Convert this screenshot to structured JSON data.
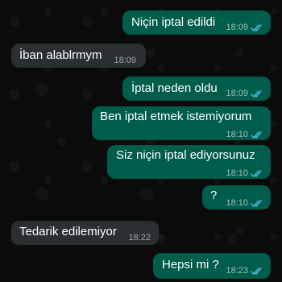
{
  "messages": [
    {
      "text": "Niçin iptal edildi",
      "time": "18:09",
      "direction": "outgoing",
      "status": "read-ticks-icon"
    },
    {
      "text": "İban alablrmym",
      "time": "18:09",
      "direction": "incoming"
    },
    {
      "text": "İptal neden oldu",
      "time": "18:09",
      "direction": "outgoing",
      "status": "read-ticks-icon"
    },
    {
      "text": "Ben iptal etmek istemiyorum",
      "time": "18:10",
      "direction": "outgoing",
      "status": "read-ticks-icon"
    },
    {
      "text": "Siz niçin iptal ediyorsunuz",
      "time": "18:10",
      "direction": "outgoing",
      "status": "read-ticks-icon"
    },
    {
      "text": "?",
      "time": "18:10",
      "direction": "outgoing",
      "status": "read-ticks-icon"
    },
    {
      "text": "Tedarik edilemiyor",
      "time": "18:22",
      "direction": "incoming"
    },
    {
      "text": "Hepsi mi ?",
      "time": "18:23",
      "direction": "outgoing",
      "status": "read-ticks-icon"
    }
  ],
  "colors": {
    "outgoing_bubble": "#005c4b",
    "incoming_bubble": "#2a2f32",
    "read_ticks": "#53bdeb",
    "background": "#0b0b0b"
  }
}
